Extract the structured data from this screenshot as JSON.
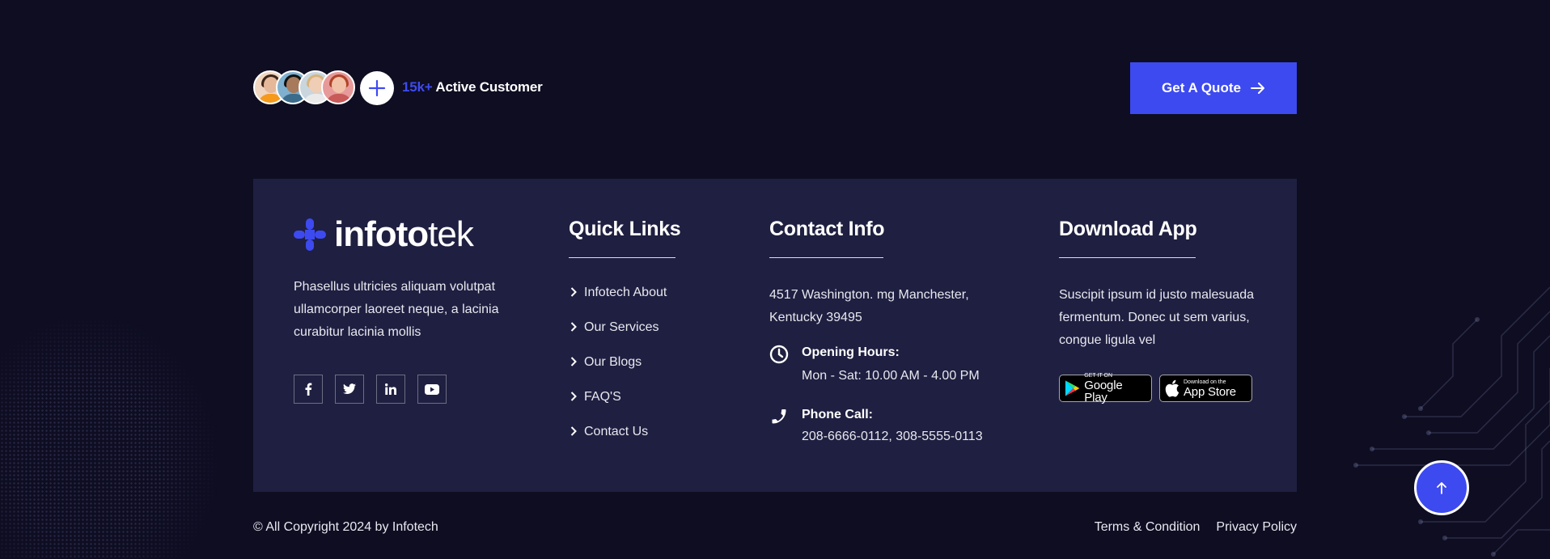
{
  "colors": {
    "background": "#0e0d22",
    "card": "#1f1f41",
    "accent": "#3d4af0",
    "text": "#e8e8f0"
  },
  "top_band": {
    "avatars": [
      "avatar-1",
      "avatar-2",
      "avatar-3",
      "avatar-4"
    ],
    "customer_count": "15k+",
    "customer_label": "Active Customer",
    "quote_button": "Get A Quote",
    "quote_icon": "arrow-right-icon"
  },
  "brand": {
    "logo_bold": "info",
    "logo_mid": "to",
    "logo_thin": "tek"
  },
  "about": {
    "text": "Phasellus ultricies aliquam volutpat ullamcorper laoreet neque, a lacinia curabitur lacinia mollis",
    "socials": [
      {
        "icon": "facebook-icon",
        "glyph": "f"
      },
      {
        "icon": "twitter-icon",
        "glyph": "t"
      },
      {
        "icon": "linkedin-icon",
        "glyph": "in"
      },
      {
        "icon": "youtube-icon",
        "glyph": "▶"
      }
    ]
  },
  "quick_links": {
    "title": "Quick Links",
    "items": [
      "Infotech About",
      "Our Services",
      "Our Blogs",
      "FAQ'S",
      "Contact Us"
    ]
  },
  "contact": {
    "title": "Contact Info",
    "address": "4517 Washington. mg Manchester, Kentucky 39495",
    "hours_label": "Opening Hours:",
    "hours_value": "Mon - Sat: 10.00 AM - 4.00 PM",
    "phone_label": "Phone Call:",
    "phone_value": "208-6666-0112, 308-5555-0113"
  },
  "app": {
    "title": "Download App",
    "text": "Suscipit ipsum id justo malesuada fermentum. Donec ut sem varius, congue ligula vel",
    "google_small": "GET IT ON",
    "google_big": "Google Play",
    "apple_small": "Download on the",
    "apple_big": "App Store"
  },
  "bottom": {
    "copyright": "© All Copyright 2024 by Infotech",
    "links": [
      "Terms & Condition",
      "Privacy Policy"
    ]
  }
}
